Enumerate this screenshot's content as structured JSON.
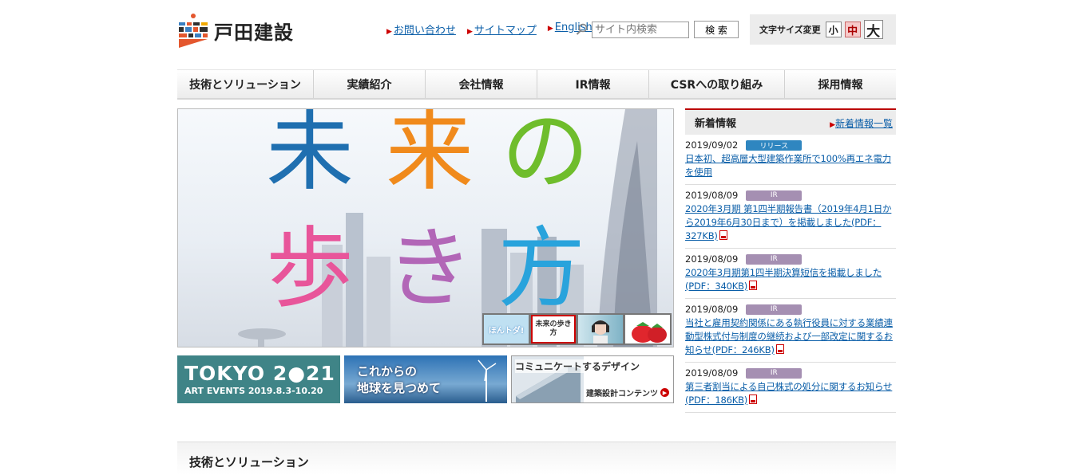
{
  "header": {
    "company_name": "戸田建設",
    "links": [
      {
        "label": "お問い合わせ"
      },
      {
        "label": "サイトマップ"
      },
      {
        "label": "English"
      }
    ],
    "search": {
      "placeholder": "サイト内検索",
      "button": "検 索"
    },
    "font_size": {
      "label": "文字サイズ変更",
      "small": "小",
      "medium": "中",
      "large": "大"
    }
  },
  "nav": [
    {
      "label": "技術とソリューション"
    },
    {
      "label": "実績紹介"
    },
    {
      "label": "会社情報"
    },
    {
      "label": "IR情報"
    },
    {
      "label": "CSRへの取り組み"
    },
    {
      "label": "採用情報"
    }
  ],
  "hero": {
    "line1": [
      "未",
      "来",
      "の"
    ],
    "line2": [
      "歩",
      "き",
      "方"
    ],
    "thumbs": [
      {
        "label": "ほんトダ!"
      },
      {
        "label": "未来の歩き方"
      },
      {
        "label": ""
      },
      {
        "label": ""
      }
    ]
  },
  "banners": [
    {
      "line1": "TOKYO 2●21",
      "line2": "ART EVENTS 2019.8.3-10.20"
    },
    {
      "line1": "これからの",
      "line2": "地球を見つめて"
    },
    {
      "line1": "コミュニケートするデザイン",
      "line2": "建築設計コンテンツ"
    }
  ],
  "news": {
    "title": "新着情報",
    "list_link": "新着情報一覧",
    "items": [
      {
        "date": "2019/09/02",
        "badge": "リリース",
        "text": "日本初、超高層大型建築作業所で100%再エネ電力を使用",
        "pdf": false
      },
      {
        "date": "2019/08/09",
        "badge": "IR",
        "text": "2020年3月期 第1四半期報告書（2019年4月1日から2019年6月30日まで）を掲載しました(PDF：327KB)",
        "pdf": true
      },
      {
        "date": "2019/08/09",
        "badge": "IR",
        "text": "2020年3月期第1四半期決算短信を掲載しました(PDF：340KB)",
        "pdf": true
      },
      {
        "date": "2019/08/09",
        "badge": "IR",
        "text": "当社と雇用契約関係にある執行役員に対する業績連動型株式付与制度の継続および一部改定に関するお知らせ(PDF：246KB)",
        "pdf": true
      },
      {
        "date": "2019/08/09",
        "badge": "IR",
        "text": "第三者割当による自己株式の処分に関するお知らせ(PDF：186KB)",
        "pdf": true
      }
    ]
  },
  "section": {
    "title": "技術とソリューション"
  },
  "colors": {
    "accent": "#b00000",
    "link": "#0a5ea8",
    "badge_release": "#2f86c0",
    "badge_ir": "#a58fb2"
  }
}
